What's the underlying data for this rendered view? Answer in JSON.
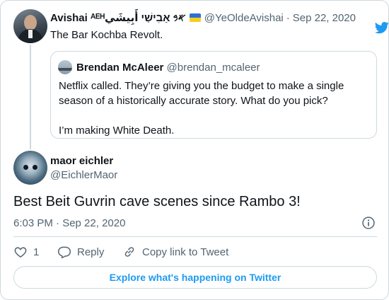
{
  "parent_tweet": {
    "author_name": "Avishai ᴬᴱᴴ𐤀𐤁 אַבִישַׁי أَبِيشَي",
    "handle": "@YeOldeAvishai",
    "separator": "·",
    "date": "Sep 22, 2020",
    "text": "The Bar Kochba Revolt."
  },
  "quoted_tweet": {
    "author_name": "Brendan McAleer",
    "handle": "@brendan_mcaleer",
    "paragraphs": [
      "Netflix called. They’re giving you the budget to make a single season of a historically accurate story. What do you pick?",
      "I’m making White Death."
    ]
  },
  "reply_tweet": {
    "author_name": "maor eichler",
    "handle": "@EichlerMaor",
    "text": "Best Beit Guvrin cave scenes since Rambo 3!",
    "timestamp": "6:03 PM · Sep 22, 2020"
  },
  "actions": {
    "like_count": "1",
    "reply_label": "Reply",
    "copy_link_label": "Copy link to Tweet"
  },
  "explore_label": "Explore what's happening on Twitter",
  "colors": {
    "accent": "#1d9bf0",
    "secondary_text": "#536471",
    "border": "#cfd9de"
  },
  "icons": [
    "twitter-bird-icon",
    "info-icon",
    "heart-icon",
    "reply-bubble-icon",
    "link-icon",
    "ukraine-flag-icon"
  ]
}
